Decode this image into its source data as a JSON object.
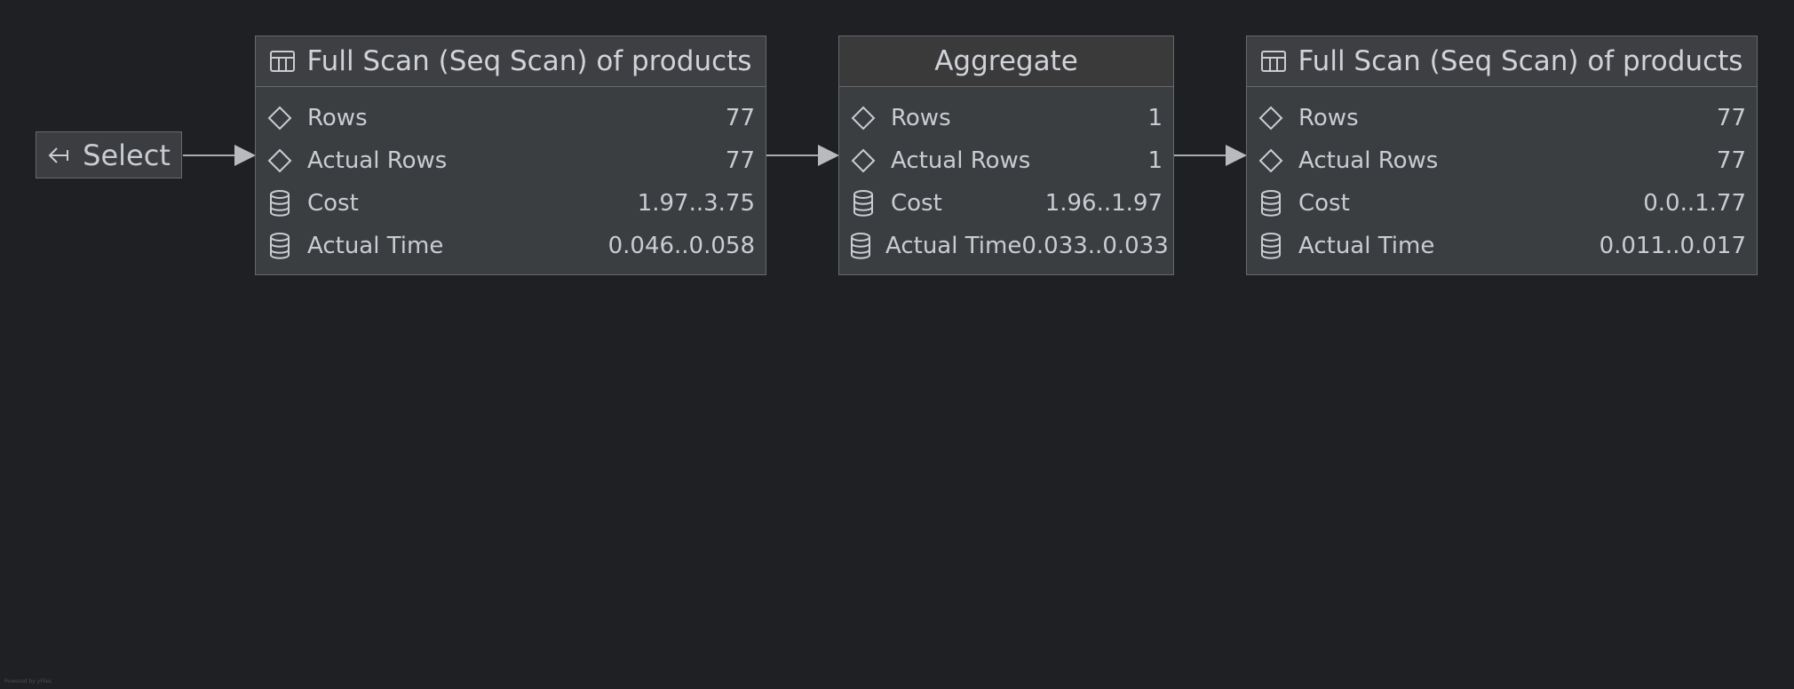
{
  "select": {
    "label": "Select",
    "icon": "arrow-left-in-icon"
  },
  "nodes": [
    {
      "title": "Full Scan (Seq Scan) of products",
      "icon": "table-icon",
      "rows": [
        {
          "icon": "diamond-icon",
          "label": "Rows",
          "value": "77"
        },
        {
          "icon": "diamond-icon",
          "label": "Actual Rows",
          "value": "77"
        },
        {
          "icon": "database-icon",
          "label": "Cost",
          "value": "1.97..3.75"
        },
        {
          "icon": "database-icon",
          "label": "Actual Time",
          "value": "0.046..0.058"
        }
      ]
    },
    {
      "title": "Aggregate",
      "icon": "",
      "rows": [
        {
          "icon": "diamond-icon",
          "label": "Rows",
          "value": "1"
        },
        {
          "icon": "diamond-icon",
          "label": "Actual Rows",
          "value": "1"
        },
        {
          "icon": "database-icon",
          "label": "Cost",
          "value": "1.96..1.97"
        },
        {
          "icon": "database-icon",
          "label": "Actual Time",
          "value": "0.033..0.033"
        }
      ]
    },
    {
      "title": "Full Scan (Seq Scan) of products",
      "icon": "table-icon",
      "rows": [
        {
          "icon": "diamond-icon",
          "label": "Rows",
          "value": "77"
        },
        {
          "icon": "diamond-icon",
          "label": "Actual Rows",
          "value": "77"
        },
        {
          "icon": "database-icon",
          "label": "Cost",
          "value": "0.0..1.77"
        },
        {
          "icon": "database-icon",
          "label": "Actual Time",
          "value": "0.011..0.017"
        }
      ]
    }
  ],
  "footer": "Powered by yFiles",
  "colors": {
    "background": "#1f2023",
    "node": "#3b3e41",
    "border": "#66686c",
    "text": "#c9ccd1",
    "edge": "#a9abae"
  }
}
